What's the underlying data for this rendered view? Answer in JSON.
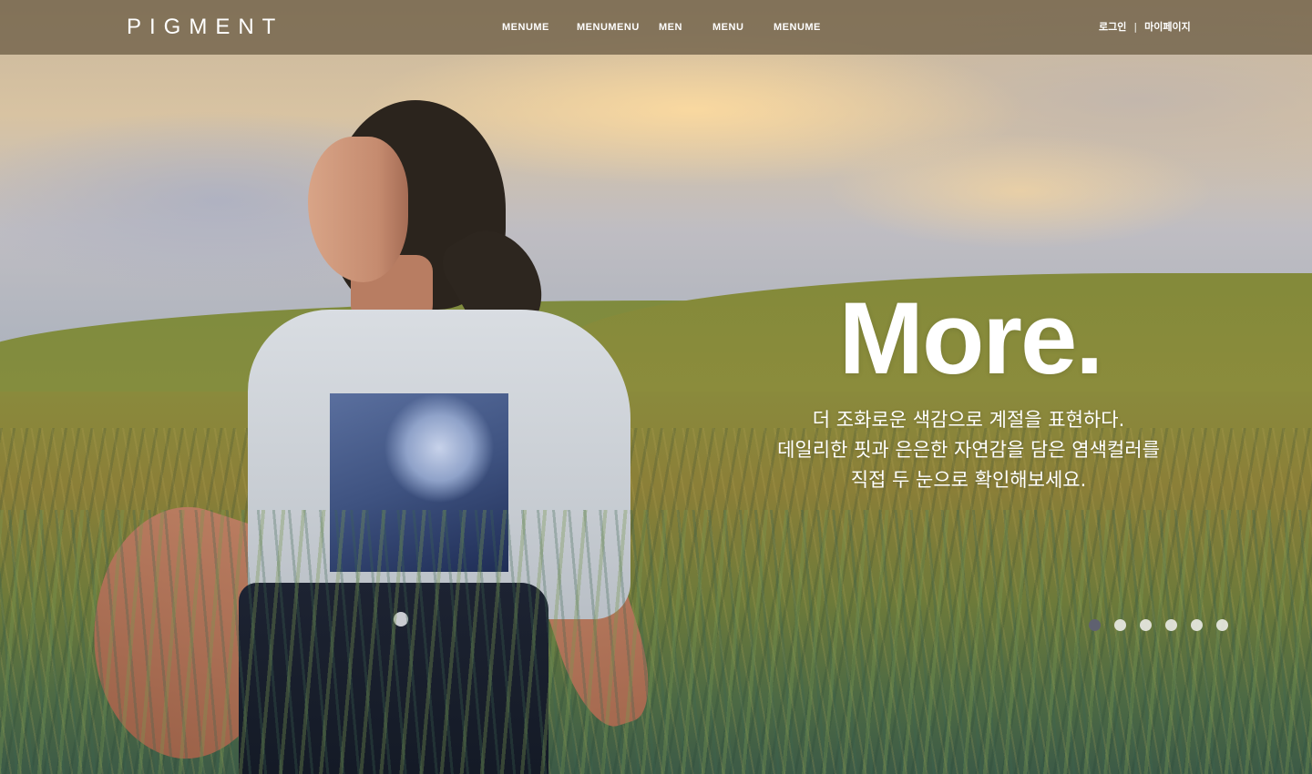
{
  "header": {
    "logo": "PIGMENT",
    "nav": [
      {
        "label": "MENUME"
      },
      {
        "label": "MENUMENU"
      },
      {
        "label": "MEN"
      },
      {
        "label": "MENU"
      },
      {
        "label": "MENUME"
      }
    ],
    "login_label": "로그인",
    "separator": "|",
    "mypage_label": "마이페이지"
  },
  "hero": {
    "headline": "More.",
    "lines": [
      "더 조화로운 색감으로 계절을 표현하다.",
      "데일리한 핏과 은은한 자연감을 담은 염색컬러를",
      "직접 두 눈으로 확인해보세요."
    ],
    "slider": {
      "total": 6,
      "active_index": 0
    }
  },
  "colors": {
    "header_bg": "#6e5f46",
    "text": "#ffffff",
    "dot_active": "#5f6170",
    "dot_inactive": "#ebebe6"
  }
}
